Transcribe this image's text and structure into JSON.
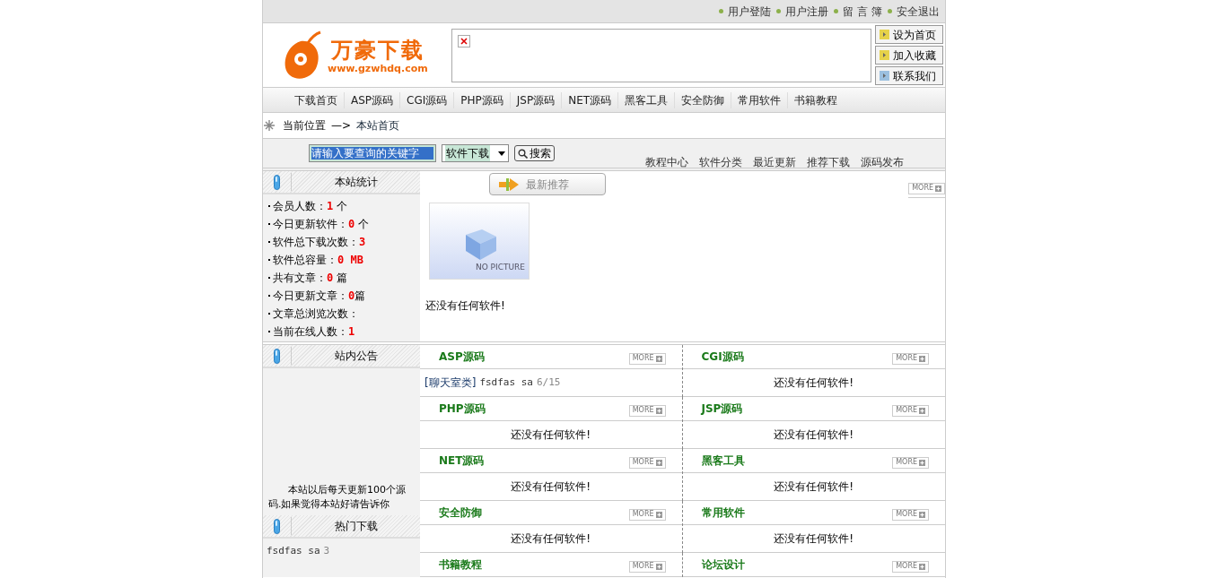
{
  "top_links": [
    "用户登陆",
    "用户注册",
    "留 言 簿",
    "安全退出"
  ],
  "logo": {
    "title": "万豪下载",
    "url": "www.gzwhdq.com"
  },
  "side_buttons": [
    "设为首页",
    "加入收藏",
    "联系我们"
  ],
  "nav": [
    "下载首页",
    "ASP源码",
    "CGI源码",
    "PHP源码",
    "JSP源码",
    "NET源码",
    "黑客工具",
    "安全防御",
    "常用软件",
    "书籍教程"
  ],
  "location": {
    "label": "当前位置",
    "arrow": "—>",
    "current": "本站首页"
  },
  "search": {
    "value": "请输入要查询的关键字",
    "category": "软件下载",
    "button": "搜索",
    "links": [
      "教程中心",
      "软件分类",
      "最近更新",
      "推荐下载",
      "源码发布"
    ]
  },
  "stats": {
    "title": "本站统计",
    "rows": [
      "会员人数：**1** 个",
      "今日更新软件：**0** 个",
      "软件总下载次数：**3**",
      "软件总容量：**0 MB**",
      "共有文章：**0** 篇",
      "今日更新文章：**0**篇",
      "文章总浏览次数：",
      "当前在线人数：**1**"
    ]
  },
  "featured": {
    "title": "最新推荐",
    "more": "MORE",
    "picture_caption": "NO PICTURE",
    "empty": "还没有任何软件!"
  },
  "notice": {
    "title": "站内公告",
    "text": "本站以后每天更新100个源码.如果觉得本站好请告诉你"
  },
  "hot": {
    "title": "热门下载",
    "items": [
      {
        "name": "fsdfas sa",
        "count": "3"
      }
    ]
  },
  "sections": [
    {
      "title": "ASP源码",
      "more": "MORE",
      "items": [
        {
          "category": "[聊天室类]",
          "name": "fsdfas sa",
          "date": "6/15"
        }
      ]
    },
    {
      "title": "CGI源码",
      "more": "MORE",
      "empty": "还没有任何软件!"
    },
    {
      "title": "PHP源码",
      "more": "MORE",
      "empty": "还没有任何软件!"
    },
    {
      "title": "JSP源码",
      "more": "MORE",
      "empty": "还没有任何软件!"
    },
    {
      "title": "NET源码",
      "more": "MORE",
      "empty": "还没有任何软件!"
    },
    {
      "title": "黑客工具",
      "more": "MORE",
      "empty": "还没有任何软件!"
    },
    {
      "title": "安全防御",
      "more": "MORE",
      "empty": "还没有任何软件!"
    },
    {
      "title": "常用软件",
      "more": "MORE",
      "empty": "还没有任何软件!"
    },
    {
      "title": "书籍教程",
      "more": "MORE"
    },
    {
      "title": "论坛设计",
      "more": "MORE"
    }
  ]
}
